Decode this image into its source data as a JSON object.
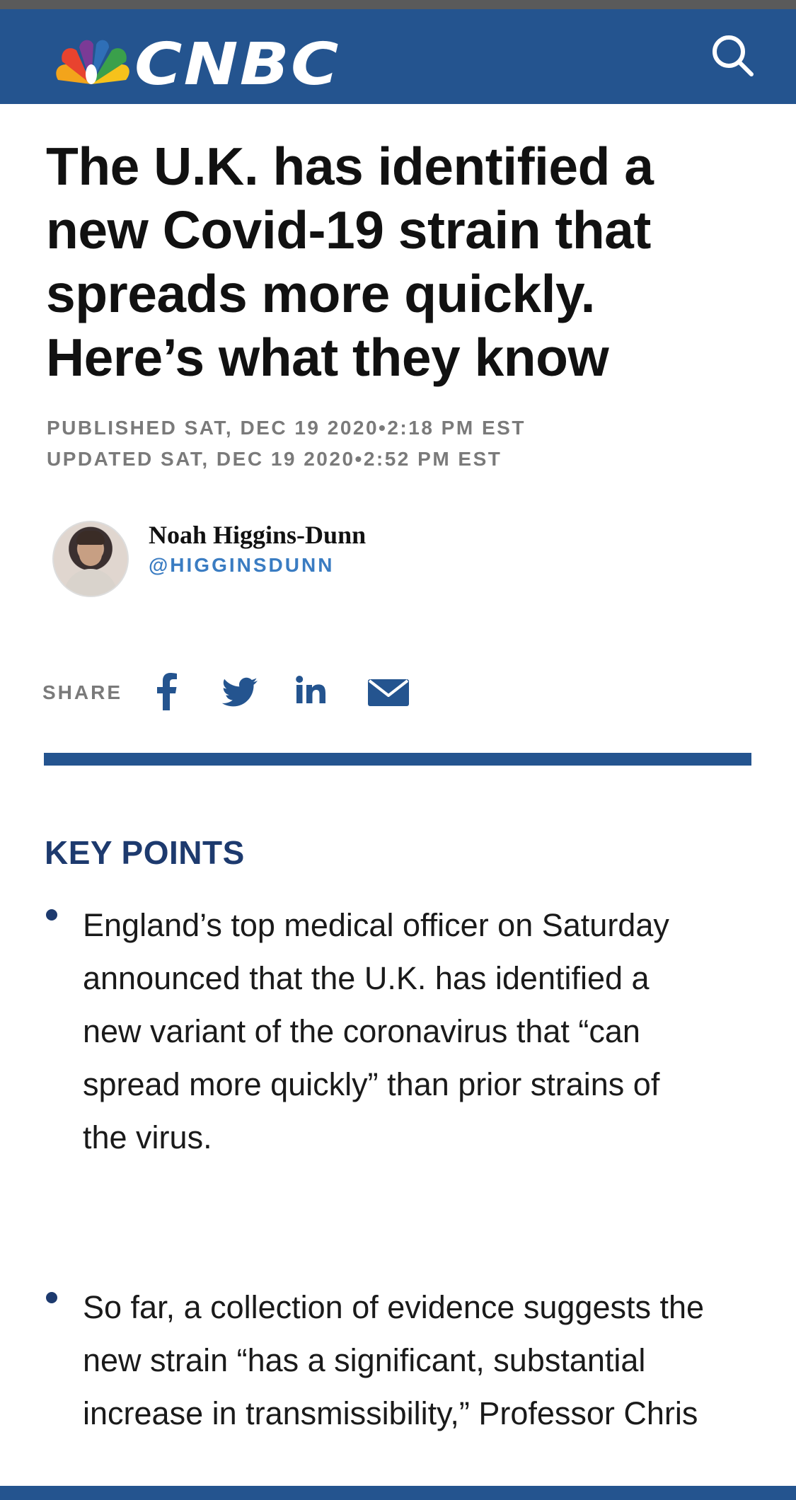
{
  "header": {
    "brand": "CNBC",
    "search_icon": "search-icon",
    "colors": {
      "bar": "#24548f",
      "peacock": [
        "#f3a41b",
        "#e8432f",
        "#7b3a96",
        "#2f6fb7",
        "#3aa04b",
        "#f6c21b"
      ]
    }
  },
  "article": {
    "headline": "The U.K. has identified a new Covid-19 strain that spreads more quickly. Here’s what they know",
    "published": "PUBLISHED SAT, DEC 19 2020•2:18 PM EST",
    "updated": "UPDATED SAT, DEC 19 2020•2:52 PM EST"
  },
  "author": {
    "name": "Noah Higgins-Dunn",
    "handle": "@HIGGINSDUNN"
  },
  "share": {
    "label": "SHARE",
    "icons": [
      "facebook-icon",
      "twitter-icon",
      "linkedin-icon",
      "email-icon"
    ]
  },
  "key_points": {
    "title": "KEY POINTS",
    "items": [
      "England’s top medical officer on Saturday announced that the U.K. has identified a new variant of the coronavirus that “can spread more quickly” than prior strains of the virus.",
      "So far, a collection of evidence suggests the new strain “has a significant, substantial increase in transmissibility,” Professor Chris"
    ]
  }
}
